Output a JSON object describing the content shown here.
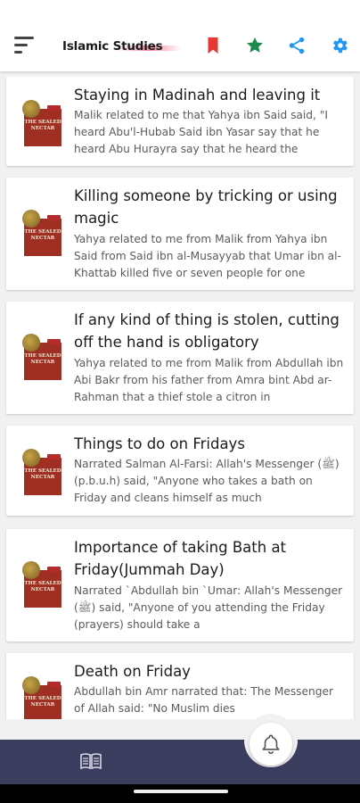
{
  "app": {
    "title": "Islamic Studies",
    "accent_red": "#e53935",
    "accent_green": "#1b8a4c",
    "accent_blue": "#2196f3",
    "nav_color": "#3b3d5e"
  },
  "toolbar": {
    "icons": [
      "menu-icon",
      "bookmark-icon",
      "star-icon",
      "share-icon",
      "gear-icon"
    ]
  },
  "thumbnail": {
    "book_text": "THE SEALED NECTAR"
  },
  "items": [
    {
      "title": "Staying in Madinah and leaving it",
      "body": "Malik related to me that Yahya ibn Said said, \"I heard Abu'l-Hubab Said ibn Yasar say that he heard Abu Hurayra say that he heard the"
    },
    {
      "title": "Killing someone by tricking or using magic",
      "body": "Yahya related to me from Malik from Yahya ibn Said from Said ibn al-Musayyab that Umar ibn al-Khattab killed five or seven people for one"
    },
    {
      "title": "If any kind of thing is stolen, cutting off the hand is obligatory",
      "body": "Yahya related to me from Malik from Abdullah ibn Abi Bakr from his father from Amra bint Abd ar-Rahman that a thief stole a citron in"
    },
    {
      "title": "Things to do on Fridays",
      "body": "Narrated Salman Al-Farsi: Allah's Messenger (ﷺ) (p.b.u.h) said, \"Anyone who takes a bath on Friday and cleans himself as much"
    },
    {
      "title": "Importance of taking Bath at Friday(Jummah Day)",
      "body": "Narrated `Abdullah bin `Umar: Allah's Messenger (ﷺ) said, \"Anyone of you attending the Friday (prayers) should take a"
    },
    {
      "title": "Death on Friday",
      "body": "Abdullah bin Amr narrated that: The Messenger of Allah said: \"No Muslim dies"
    }
  ],
  "bottom_nav": {
    "icons": [
      "book-icon",
      "bell-icon"
    ]
  }
}
